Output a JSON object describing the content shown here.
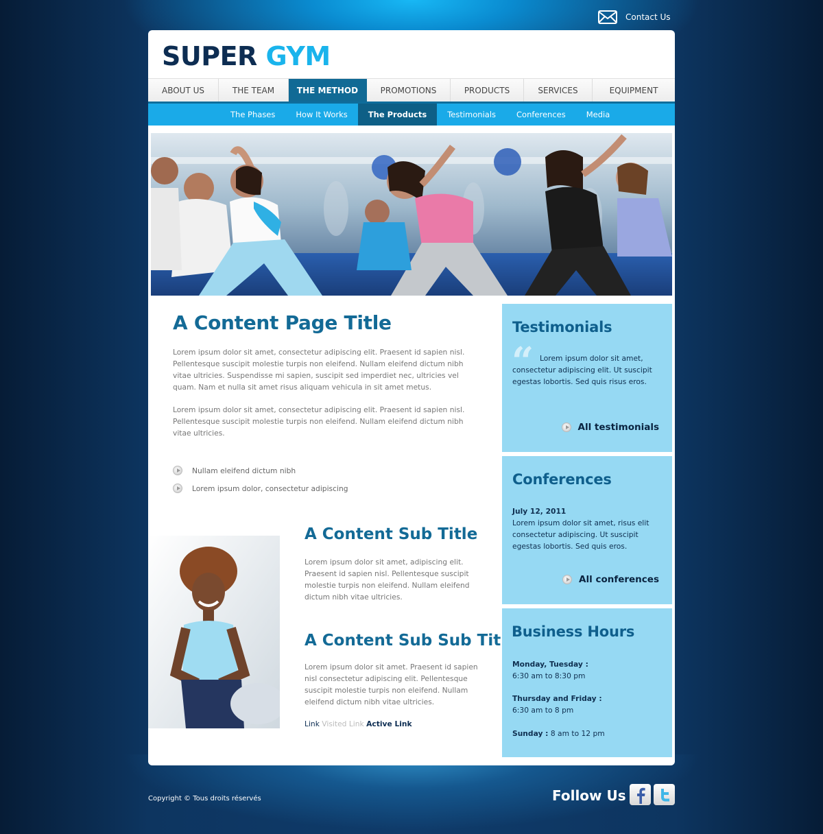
{
  "header": {
    "contact_label": "Contact Us",
    "logo_part1": "SUPER",
    "logo_part2": "GYM"
  },
  "main_nav": [
    {
      "label": "ABOUT US",
      "active": false
    },
    {
      "label": "THE TEAM",
      "active": false
    },
    {
      "label": "THE METHOD",
      "active": true
    },
    {
      "label": "PROMOTIONS",
      "active": false
    },
    {
      "label": "PRODUCTS",
      "active": false
    },
    {
      "label": "SERVICES",
      "active": false
    },
    {
      "label": "EQUIPMENT",
      "active": false
    }
  ],
  "sub_nav": [
    {
      "label": "The Phases",
      "active": false
    },
    {
      "label": "How It Works",
      "active": false
    },
    {
      "label": "The Products",
      "active": true
    },
    {
      "label": "Testimonials",
      "active": false
    },
    {
      "label": "Conferences",
      "active": false
    },
    {
      "label": "Media",
      "active": false
    }
  ],
  "content": {
    "title": "A Content Page Title",
    "para1": "Lorem ipsum dolor sit amet, consectetur adipiscing elit. Praesent id sapien nisl. Pellentesque suscipit molestie turpis non eleifend. Nullam eleifend dictum nibh vitae ultricies. Suspendisse mi sapien, suscipit sed imperdiet nec, ultricies vel quam. Nam et nulla sit amet risus aliquam vehicula in sit amet metus.",
    "para2": "Lorem ipsum dolor sit amet, consectetur adipiscing elit. Praesent id sapien nisl. Pellentesque suscipit molestie turpis non eleifend. Nullam eleifend dictum nibh vitae ultricies.",
    "bullets": [
      "Nullam eleifend dictum nibh",
      "Lorem ipsum dolor, consectetur adipiscing"
    ],
    "sub_title": "A Content Sub Title",
    "sub_para": "Lorem ipsum dolor sit amet, adipiscing elit. Praesent id sapien nisl. Pellentesque suscipit molestie turpis non eleifend. Nullam eleifend dictum nibh vitae ultricies.",
    "sub_sub_title": "A Content Sub Sub Title",
    "sub_sub_para": "Lorem ipsum dolor sit amet. Praesent id sapien nisl consectetur adipiscing elit. Pellentesque suscipit molestie turpis non eleifend. Nullam eleifend dictum nibh vitae ultricies.",
    "link": "Link",
    "visited_link": "Visited Link",
    "active_link": "Active Link"
  },
  "sidebar": {
    "testimonials": {
      "title": "Testimonials",
      "quote_mark": "“",
      "text": "Lorem ipsum dolor sit amet, consectetur adipiscing elit. Ut suscipit egestas lobortis. Sed quis risus eros.",
      "more": "All testimonials"
    },
    "conferences": {
      "title": "Conferences",
      "date": "July 12, 2011",
      "text": "Lorem ipsum dolor sit amet, risus elit consectetur adipiscing. Ut suscipit egestas lobortis. Sed quis eros.",
      "more": "All conferences"
    },
    "hours": {
      "title": "Business Hours",
      "day1": "Monday, Tuesday :",
      "time1": "6:30 am to 8:30 pm",
      "day2": "Thursday and Friday :",
      "time2": "6:30 am to 8 pm",
      "day3": "Sunday :",
      "time3": "8 am to 12 pm"
    }
  },
  "footer": {
    "copyright": "Copyright © Tous droits réservés",
    "follow": "Follow Us",
    "social": [
      "facebook-icon",
      "twitter-icon"
    ]
  },
  "colors": {
    "brand_dark": "#0d2d52",
    "brand_light": "#1ab4ec",
    "nav_active": "#116a95",
    "subnav_bg": "#1aaae8",
    "sidebar_bg": "#96d9f3",
    "title": "#136a96"
  }
}
